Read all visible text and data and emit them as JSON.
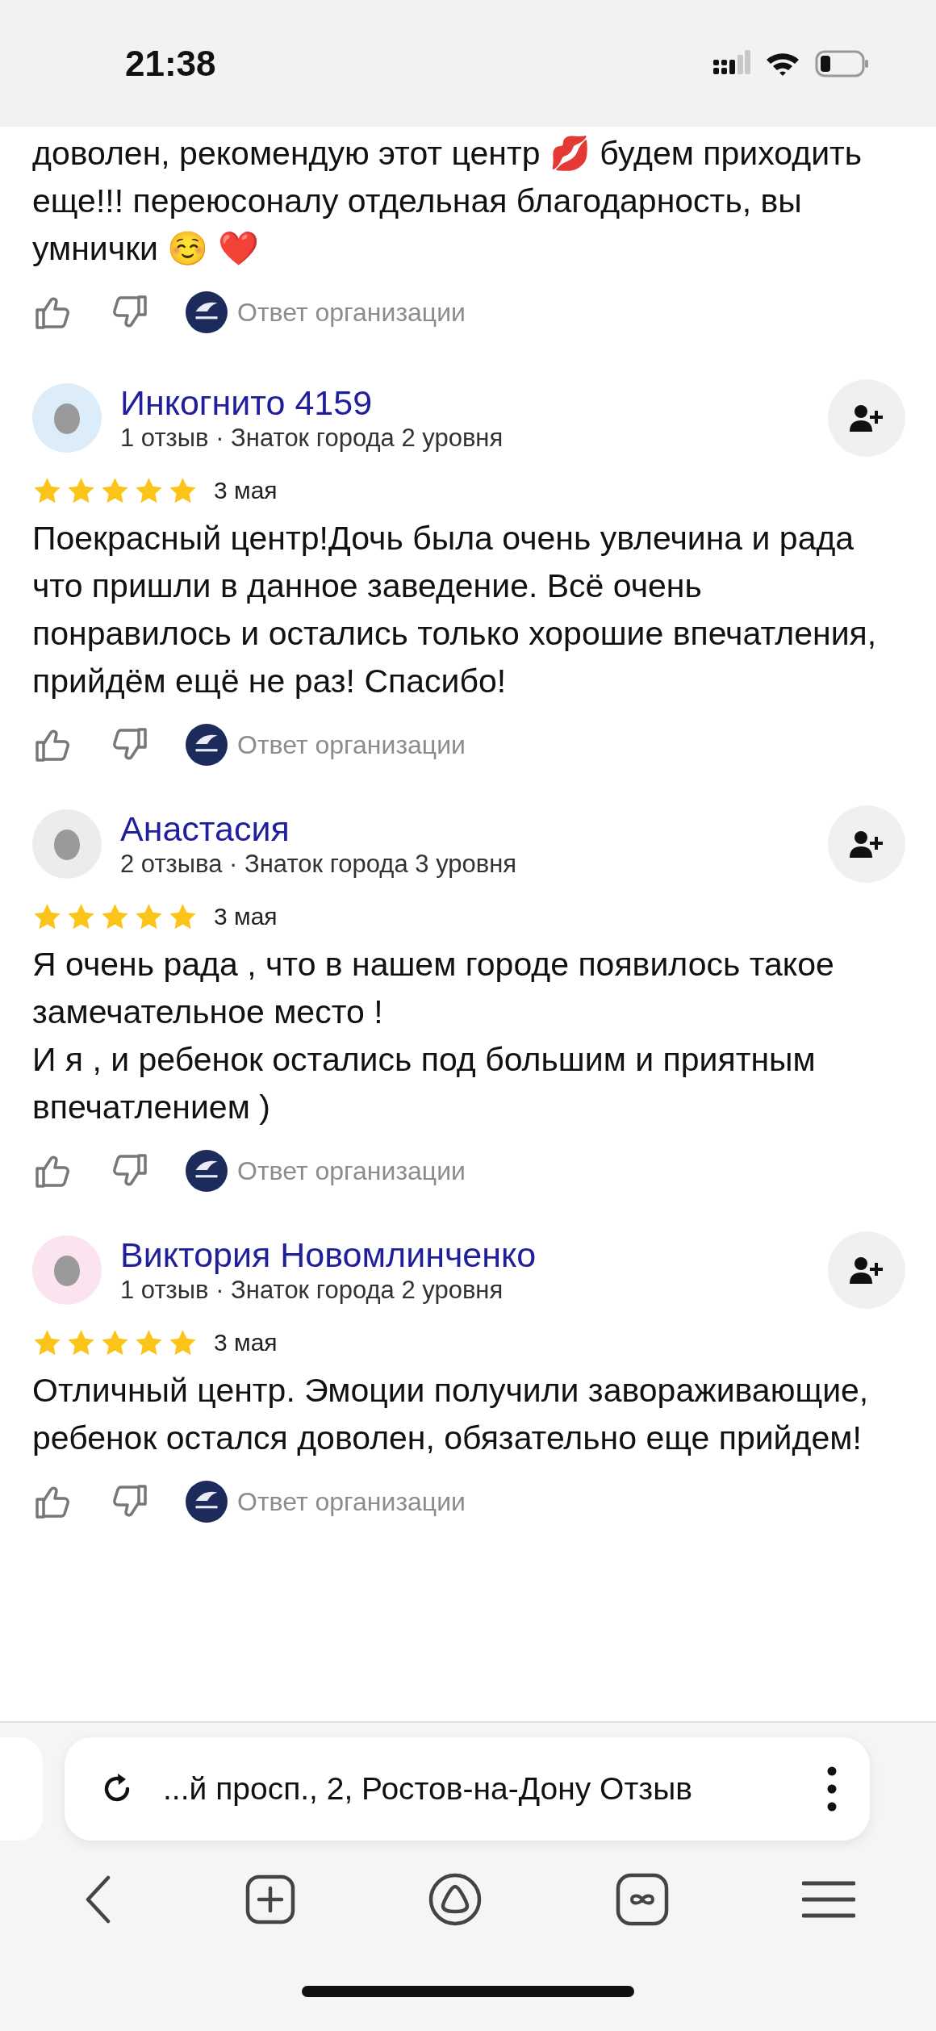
{
  "status_bar": {
    "time": "21:38"
  },
  "top_review": {
    "text": "доволен, рекомендую этот центр 💋 будем приходить еще!!! переюсоналу отдельная благодарность, вы умнички ☺️ ❤️",
    "reply_label": "Ответ организации"
  },
  "reviews": [
    {
      "author": "Инкогнито 4159",
      "color": "#dcedf9",
      "meta": "1 отзыв · Знаток города 2 уровня",
      "stars": 5,
      "date": "3 мая",
      "text": "Поекрасный центр!Дочь была очень увлечина и рада что пришли в данное заведение. Всё очень понравилось и остались только хорошие впечатления, прийдём ещё не раз! Спасибо!",
      "reply_label": "Ответ организации"
    },
    {
      "author": "Анастасия",
      "color": "#ececec",
      "meta": "2 отзыва · Знаток города 3 уровня",
      "stars": 5,
      "date": "3 мая",
      "text": "Я очень рада , что в нашем городе появилось такое замечательное место !\nИ я , и ребенок остались под большим и приятным впечатлением )",
      "reply_label": "Ответ организации"
    },
    {
      "author": "Виктория Новомлинченко",
      "color": "#fbe3f0",
      "meta": "1 отзыв · Знаток города 2 уровня",
      "stars": 5,
      "date": "3 мая",
      "text": "Отличный центр. Эмоции получили завораживающие, ребенок остался доволен, обязательно еще прийдем!",
      "reply_label": "Ответ организации"
    }
  ],
  "address_bar": {
    "text": "...й просп., 2, Ростов-на-Дону Отзыв"
  }
}
